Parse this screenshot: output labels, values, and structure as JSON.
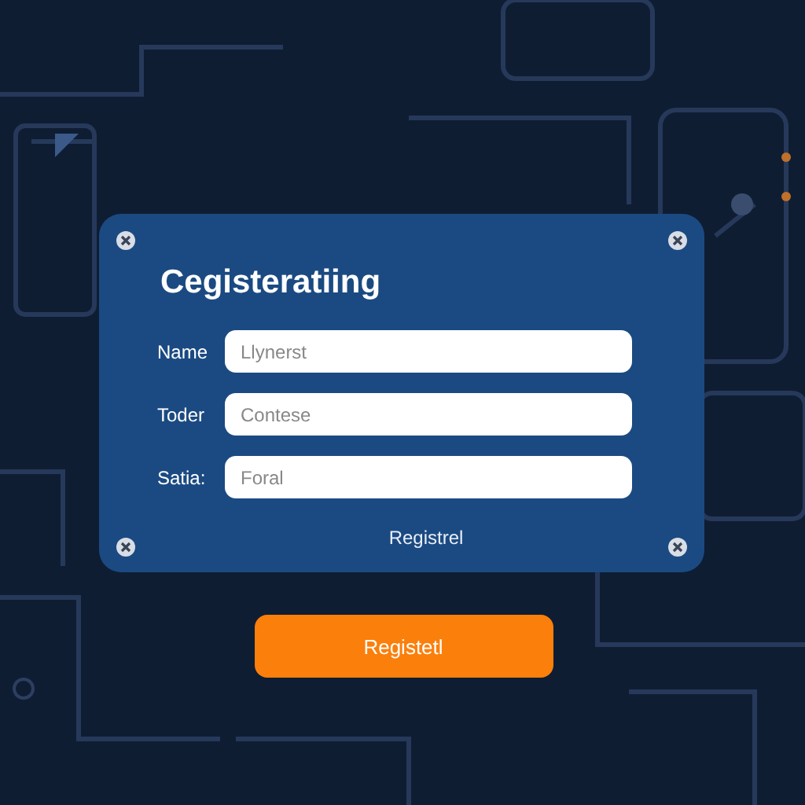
{
  "form": {
    "title": "Cegisteratiing",
    "fields": [
      {
        "label": "Name",
        "placeholder": "Llynerst"
      },
      {
        "label": "Toder",
        "placeholder": "Contese"
      },
      {
        "label": "Satia:",
        "placeholder": "Foral"
      }
    ],
    "link": "Registrel"
  },
  "button": "Registetl"
}
